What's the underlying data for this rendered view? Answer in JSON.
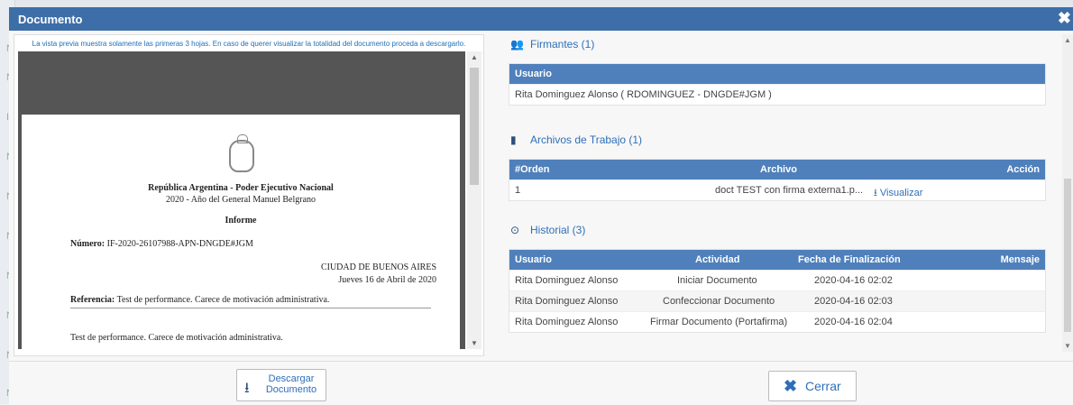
{
  "window": {
    "title": "Documento",
    "close_icon": "close-icon"
  },
  "preview": {
    "note": "La vista previa muestra solamente las primeras 3 hojas. En caso de querer visualizar la totalidad del documento proceda a descargarlo.",
    "doc": {
      "line1": "República Argentina - Poder Ejecutivo Nacional",
      "line2": "2020 - Año del General Manuel Belgrano",
      "type": "Informe",
      "numero_label": "Número:",
      "numero": "IF-2020-26107988-APN-DNGDE#JGM",
      "city": "CIUDAD DE BUENOS AIRES",
      "date": "Jueves 16 de Abril de 2020",
      "ref_label": "Referencia:",
      "ref": "Test de performance. Carece de motivación administrativa.",
      "body": "Test de performance. Carece de motivación administrativa."
    }
  },
  "firmantes": {
    "title": "Firmantes (1)",
    "header": "Usuario",
    "rows": [
      "Rita Dominguez Alonso ( RDOMINGUEZ - DNGDE#JGM )"
    ]
  },
  "archivos": {
    "title": "Archivos de Trabajo (1)",
    "headers": [
      "#Orden",
      "Archivo",
      "Acción"
    ],
    "rows": [
      {
        "orden": "1",
        "archivo": "doct TEST con firma externa1.p...",
        "accion": "Visualizar"
      }
    ]
  },
  "historial": {
    "title": "Historial (3)",
    "headers": [
      "Usuario",
      "Actividad",
      "Fecha de Finalización",
      "Mensaje"
    ],
    "rows": [
      {
        "usuario": "Rita Dominguez Alonso",
        "actividad": "Iniciar Documento",
        "fecha": "2020-04-16 02:02"
      },
      {
        "usuario": "Rita Dominguez Alonso",
        "actividad": "Confeccionar Documento",
        "fecha": "2020-04-16 02:03"
      },
      {
        "usuario": "Rita Dominguez Alonso",
        "actividad": "Firmar Documento (Portafirma)",
        "fecha": "2020-04-16 02:04"
      }
    ]
  },
  "footer": {
    "download_l1": "Descargar",
    "download_l2": "Documento",
    "close": "Cerrar"
  },
  "colors": {
    "header": "#3d6ea8",
    "table_head": "#4f80bb",
    "link": "#2f6fb8"
  },
  "background": {
    "left_letters": [
      "N",
      "N",
      "IF",
      "N",
      "N",
      "N",
      "N",
      "N",
      "N",
      "N"
    ]
  }
}
